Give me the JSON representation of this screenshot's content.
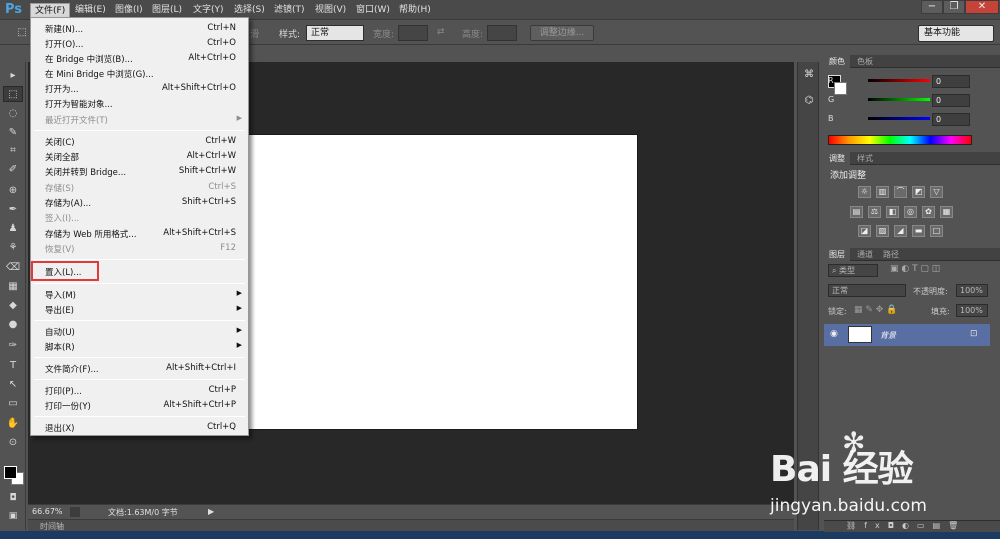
{
  "app": {
    "logo": "Ps"
  },
  "menubar": {
    "items": [
      "文件(F)",
      "编辑(E)",
      "图像(I)",
      "图层(L)",
      "文字(Y)",
      "选择(S)",
      "滤镜(T)",
      "视图(V)",
      "窗口(W)",
      "帮助(H)"
    ],
    "window_buttons": {
      "minimize": "−",
      "restore": "❐",
      "close": "✕"
    }
  },
  "optbar": {
    "feather_tail": "滑",
    "style_label": "样式:",
    "style_value": "正常",
    "width_label": "宽度:",
    "height_label": "高度:",
    "refine_edge": "调整边缘...",
    "workspace": "基本功能"
  },
  "file_menu": {
    "items": [
      {
        "label": "新建(N)...",
        "shortcut": "Ctrl+N"
      },
      {
        "label": "打开(O)...",
        "shortcut": "Ctrl+O"
      },
      {
        "label": "在 Bridge 中浏览(B)...",
        "shortcut": "Alt+Ctrl+O"
      },
      {
        "label": "在 Mini Bridge 中浏览(G)...",
        "shortcut": ""
      },
      {
        "label": "打开为...",
        "shortcut": "Alt+Shift+Ctrl+O"
      },
      {
        "label": "打开为智能对象...",
        "shortcut": ""
      },
      {
        "label": "最近打开文件(T)",
        "shortcut": ""
      },
      {
        "label": "关闭(C)",
        "shortcut": "Ctrl+W"
      },
      {
        "label": "关闭全部",
        "shortcut": "Alt+Ctrl+W"
      },
      {
        "label": "关闭并转到 Bridge...",
        "shortcut": "Shift+Ctrl+W"
      },
      {
        "label": "存储(S)",
        "shortcut": "Ctrl+S"
      },
      {
        "label": "存储为(A)...",
        "shortcut": "Shift+Ctrl+S"
      },
      {
        "label": "签入(I)...",
        "shortcut": ""
      },
      {
        "label": "存储为 Web 所用格式...",
        "shortcut": "Alt+Shift+Ctrl+S"
      },
      {
        "label": "恢复(V)",
        "shortcut": "F12"
      },
      {
        "label": "置入(L)...",
        "shortcut": ""
      },
      {
        "label": "导入(M)",
        "shortcut": ""
      },
      {
        "label": "导出(E)",
        "shortcut": ""
      },
      {
        "label": "自动(U)",
        "shortcut": ""
      },
      {
        "label": "脚本(R)",
        "shortcut": ""
      },
      {
        "label": "文件简介(F)...",
        "shortcut": "Alt+Shift+Ctrl+I"
      },
      {
        "label": "打印(P)...",
        "shortcut": "Ctrl+P"
      },
      {
        "label": "打印一份(Y)",
        "shortcut": "Alt+Shift+Ctrl+P"
      },
      {
        "label": "退出(X)",
        "shortcut": "Ctrl+Q"
      }
    ],
    "submenu_arrow": "▶"
  },
  "tools": [
    "▸",
    "⬚",
    "◌",
    "✎",
    "⌗",
    "✐",
    "⊕",
    "✒",
    "♟",
    "⚘",
    "⌫",
    "▦",
    "◆",
    "●",
    "✑",
    "T",
    "↖",
    "▭",
    "✋",
    "⊙"
  ],
  "panel_strip": {
    "icons": [
      "⌘",
      "⌬"
    ]
  },
  "color_panel": {
    "tabs": [
      "颜色",
      "色板"
    ],
    "r_label": "R",
    "r_value": "0",
    "g_label": "G",
    "g_value": "0",
    "b_label": "B",
    "b_value": "0"
  },
  "adjust_panel": {
    "tabs": [
      "调整",
      "样式"
    ],
    "title": "添加调整"
  },
  "layers_panel": {
    "tabs": [
      "图层",
      "通道",
      "路径"
    ],
    "kind_filter": "类型",
    "blend_mode": "正常",
    "opacity_label": "不透明度:",
    "opacity_value": "100%",
    "lock_label": "锁定:",
    "fill_label": "填充:",
    "fill_value": "100%",
    "layer_name": "背景"
  },
  "status": {
    "zoom": "66.67%",
    "doc_info": "文档:1.63M/0 字节",
    "arrow": "▶",
    "mini_bridge": "时间轴"
  },
  "watermark": {
    "logo": "Bai 经验",
    "url": "jingyan.baidu.com"
  }
}
